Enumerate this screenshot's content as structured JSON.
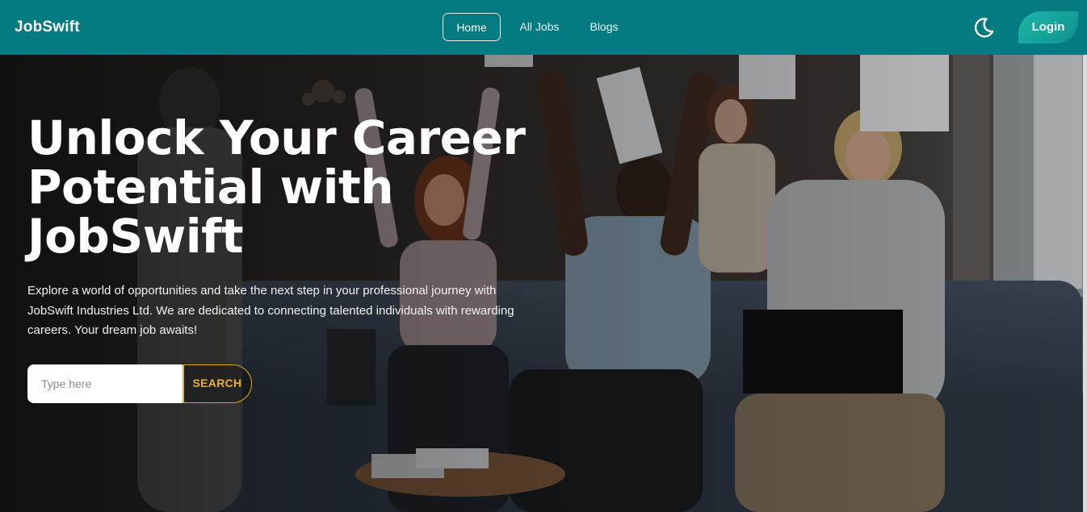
{
  "navbar": {
    "brand": "JobSwift",
    "links": [
      {
        "label": "Home",
        "active": true
      },
      {
        "label": "All Jobs"
      },
      {
        "label": "Blogs"
      }
    ],
    "theme_toggle_icon": "moon-icon",
    "login_label": "Login",
    "colors": {
      "bar": "#047b80",
      "login": "#15a39a"
    }
  },
  "hero": {
    "title": "Unlock Your Career Potential with JobSwift",
    "description": "Explore a world of opportunities and take the next step in your professional journey with JobSwift Industries Ltd. We are dedicated to connecting talented individuals with rewarding careers. Your dream job awaits!",
    "search": {
      "placeholder": "Type here",
      "value": "",
      "button_label": "SEARCH"
    },
    "background_image": "people-celebrating-throwing-papers",
    "accent": "#e3a51e"
  }
}
